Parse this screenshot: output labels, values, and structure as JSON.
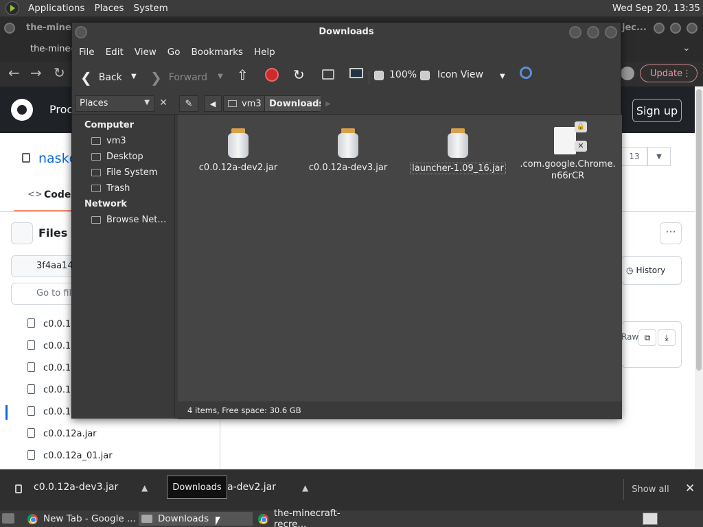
{
  "top_panel": {
    "menus": [
      "Applications",
      "Places",
      "System"
    ],
    "clock": "Wed Sep 20, 13:35"
  },
  "chrome": {
    "tab_left_title": "the-minec",
    "tab_right_title": "jec...",
    "window_title_fragment": "the-minecr",
    "update_label": "Update",
    "update_menu": "⋮"
  },
  "github": {
    "product_label": "Proc",
    "signup_label": "Sign up",
    "repo_name": "naskc",
    "code_tab": "Code",
    "files_title": "Files",
    "branch": "3f4aa14",
    "goto_placeholder": "Go to file",
    "files": [
      "c0.0.1",
      "c0.0.1",
      "c0.0.1",
      "c0.0.1",
      "c0.0.1",
      "c0.0.12a.jar",
      "c0.0.12a_01.jar"
    ],
    "history_label": "History",
    "count_badge": "13",
    "raw_label": "Raw",
    "more_label": "···"
  },
  "downloads_bar": {
    "items": [
      "c0.0.12a-dev3.jar",
      "a-dev2.jar"
    ],
    "show_all": "Show all",
    "close": "✕"
  },
  "tooltip": "Downloads",
  "taskbar": {
    "tasks": [
      "New Tab - Google ...",
      "Downloads",
      "the-minecraft-recre..."
    ],
    "active_index": 1
  },
  "file_manager": {
    "title": "Downloads",
    "menu": [
      "File",
      "Edit",
      "View",
      "Go",
      "Bookmarks",
      "Help"
    ],
    "toolbar": {
      "back": "Back",
      "forward": "Forward",
      "zoom": "100%",
      "view_mode": "Icon View"
    },
    "places_label": "Places",
    "breadcrumbs": [
      "vm3",
      "Downloads"
    ],
    "sidebar": {
      "computer_heading": "Computer",
      "computer_items": [
        "vm3",
        "Desktop",
        "File System",
        "Trash"
      ],
      "network_heading": "Network",
      "network_items": [
        "Browse Net…"
      ]
    },
    "files": [
      {
        "name": "c0.0.12a-dev2.jar",
        "icon": "jar-icon",
        "selected": false
      },
      {
        "name": "c0.0.12a-dev3.jar",
        "icon": "jar-icon",
        "selected": false
      },
      {
        "name": "launcher-1.09_16.jar",
        "icon": "jar-icon",
        "selected": true
      },
      {
        "name": ".com.google.Chrome.\nn66rCR",
        "icon": "locked-document-icon",
        "selected": false
      }
    ],
    "status": "4 items, Free space: 30.6 GB"
  }
}
